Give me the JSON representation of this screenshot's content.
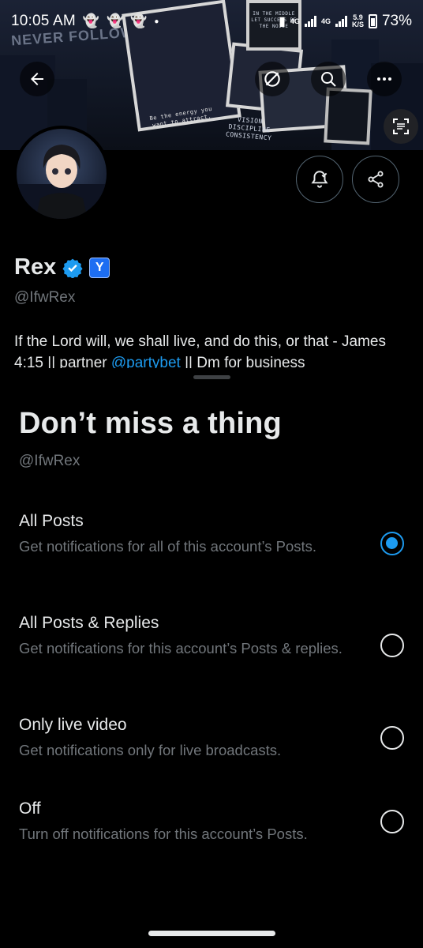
{
  "status_bar": {
    "time": "10:05 AM",
    "network_small": "4G",
    "network_tag": "4G",
    "speed_top": "5.9",
    "speed_bottom": "K/S",
    "battery": "73%"
  },
  "banner": {
    "tagline": "NEVER FOLLOW",
    "poster_vision": "VISION DISCIPLINE CONSISTENCY",
    "poster_energy": "Be the energy you want to attract.",
    "poster_small": "IN THE MIDDLE LET SUCCESS BE THE NOISE"
  },
  "profile": {
    "name": "Rex",
    "handle": "@IfwRex",
    "bio_text": "If the Lord will, we shall live, and do this, or that - James 4:15 || partner ",
    "bio_link": "@partybet",
    "bio_tail": " || Dm for business"
  },
  "sheet": {
    "title": "Don’t miss a thing",
    "handle": "@IfwRex",
    "options": [
      {
        "title": "All Posts",
        "description": "Get notifications for all of this account’s Posts.",
        "selected": true
      },
      {
        "title": "All Posts & Replies",
        "description": "Get notifications for this account’s Posts & replies.",
        "selected": false
      },
      {
        "title": "Only live video",
        "description": "Get notifications only for live broadcasts.",
        "selected": false
      },
      {
        "title": "Off",
        "description": "Turn off notifications for this account’s Posts.",
        "selected": false
      }
    ]
  },
  "colors": {
    "accent": "#1d9bf0",
    "text_primary": "#e7e9ea",
    "text_secondary": "#71767b",
    "background": "#000000"
  },
  "icons": {
    "back": "arrow-left-icon",
    "grok": "grok-icon",
    "search": "search-icon",
    "more": "more-icon",
    "scan": "scan-text-icon",
    "bell": "bell-check-icon",
    "share": "share-icon",
    "verified": "verified-badge-icon",
    "affiliate": "affiliate-badge-icon"
  }
}
